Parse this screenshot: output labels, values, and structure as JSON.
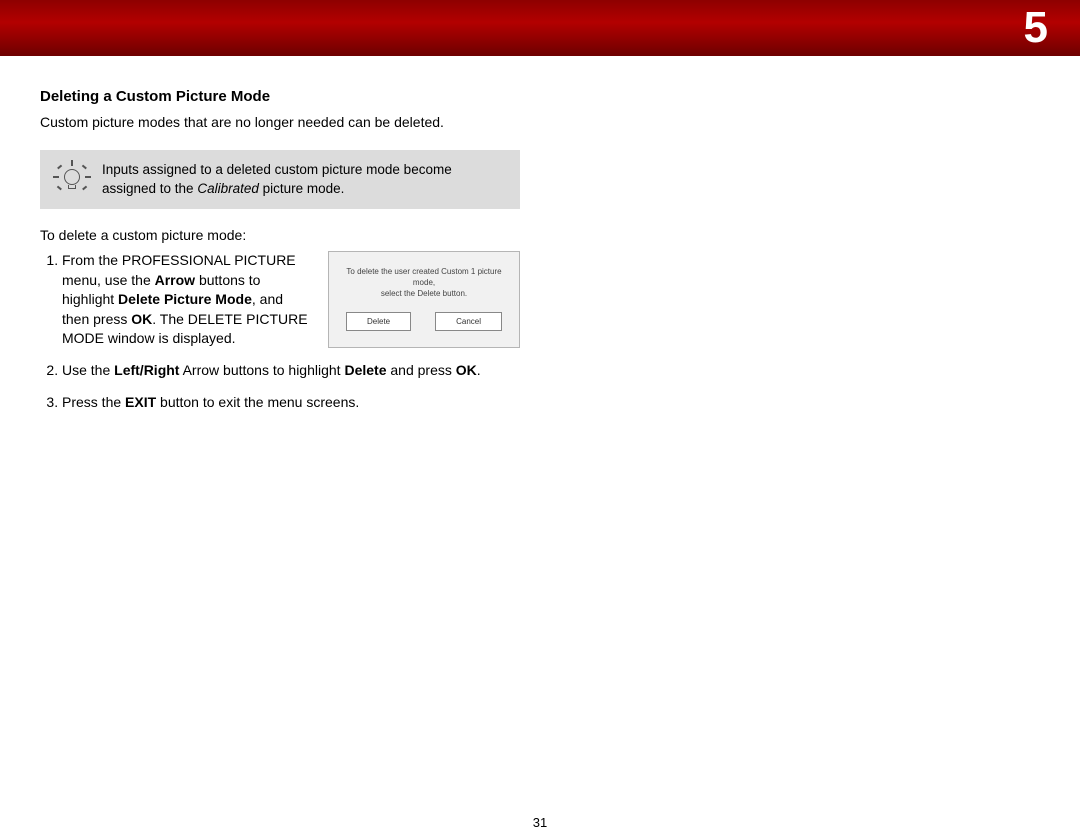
{
  "header": {
    "chapter_number": "5"
  },
  "section": {
    "heading": "Deleting a Custom Picture Mode",
    "intro": "Custom picture modes that are no longer needed can be deleted.",
    "tip_prefix": "Inputs assigned to a deleted custom picture mode become assigned to the ",
    "tip_italic": "Calibrated",
    "tip_suffix": " picture mode.",
    "lead_in": "To delete a custom picture mode:",
    "steps": {
      "s1_a": "From the PROFESSIONAL PICTURE menu, use the ",
      "s1_b1": "Arrow",
      "s1_c": " buttons to highlight ",
      "s1_b2": "Delete Picture Mode",
      "s1_d": ", and then press ",
      "s1_b3": "OK",
      "s1_e": ". The DELETE PICTURE MODE window is displayed.",
      "s2_a": "Use the ",
      "s2_b1": "Left/Right",
      "s2_b": " Arrow buttons to highlight ",
      "s2_b2": "Delete",
      "s2_c": " and press ",
      "s2_b3": "OK",
      "s2_d": ".",
      "s3_a": "Press the ",
      "s3_b1": "EXIT",
      "s3_b": " button to exit the menu screens."
    }
  },
  "dialog": {
    "line1": "To delete the user created Custom 1 picture mode,",
    "line2": "select the Delete button.",
    "delete": "Delete",
    "cancel": "Cancel"
  },
  "page_number": "31"
}
